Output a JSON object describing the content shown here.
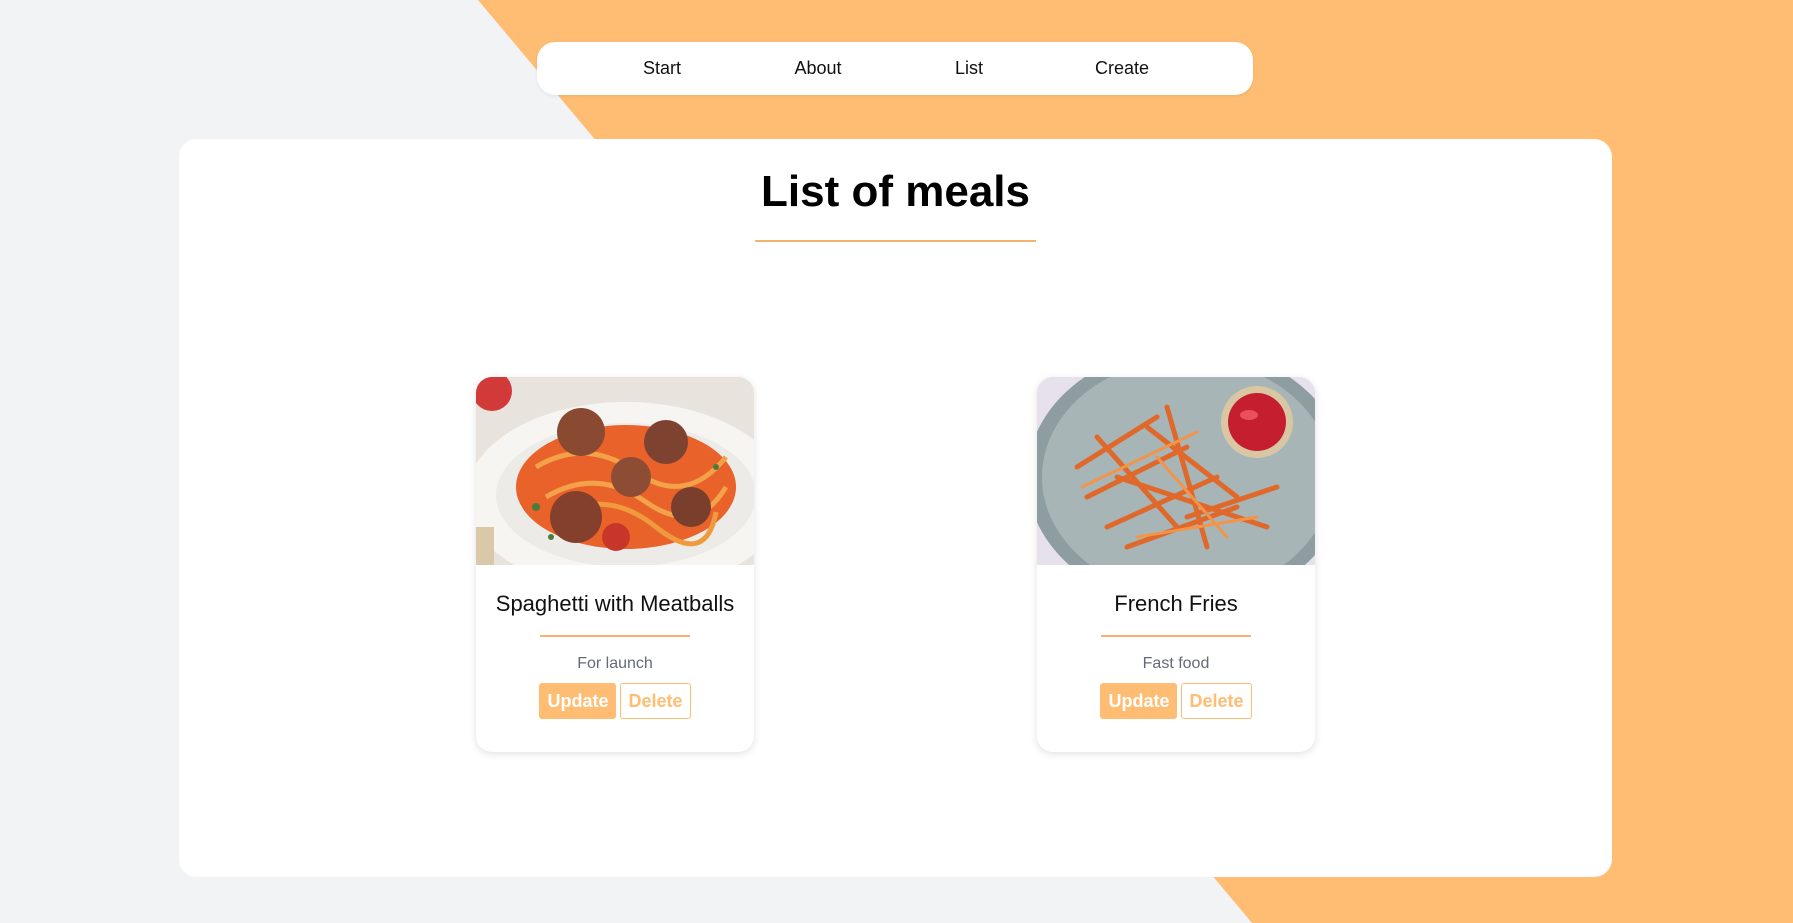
{
  "nav": {
    "items": [
      {
        "label": "Start"
      },
      {
        "label": "About"
      },
      {
        "label": "List"
      },
      {
        "label": "Create"
      }
    ]
  },
  "main": {
    "title": "List of meals"
  },
  "meals": [
    {
      "name": "Spaghetti with Meatballs",
      "category": "For launch",
      "update_label": "Update",
      "delete_label": "Delete",
      "image": "spaghetti-meatballs-photo"
    },
    {
      "name": "French Fries",
      "category": "Fast food",
      "update_label": "Update",
      "delete_label": "Delete",
      "image": "french-fries-photo"
    }
  ],
  "colors": {
    "accent": "#ffbd73",
    "background": "#f2f3f5",
    "card": "#ffffff"
  }
}
